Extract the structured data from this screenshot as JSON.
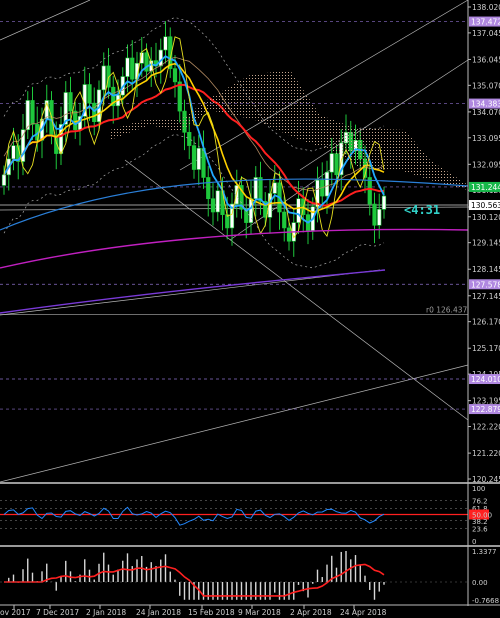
{
  "chart_data": {
    "type": "candlestick",
    "price_axis": {
      "ticks": [
        "138.020",
        "137.045",
        "136.045",
        "135.070",
        "134.070",
        "133.095",
        "132.095",
        "131.120",
        "130.120",
        "129.145",
        "128.145",
        "127.145",
        "126.170",
        "125.170",
        "124.195",
        "123.195",
        "122.220",
        "121.220",
        "120.245"
      ],
      "levels": [
        {
          "label": "137.472",
          "price": 137.472,
          "color": "#b088e0"
        },
        {
          "label": "134.383",
          "price": 134.383,
          "color": "#b088e0"
        },
        {
          "label": "131.244",
          "price": 131.244,
          "color": "#17b84a"
        },
        {
          "label": "130.563",
          "price": 130.563,
          "color": "#ffffff"
        },
        {
          "label": "127.578",
          "price": 127.578,
          "color": "#b088e0"
        },
        {
          "label": "124.010",
          "price": 124.01,
          "color": "#b088e0"
        },
        {
          "label": "122.879",
          "price": 122.879,
          "color": "#b088e0"
        }
      ],
      "fibo_note": "r0 126.437"
    },
    "countdown": "<4:31",
    "date_labels": [
      "ov 2017",
      "7 Dec 2017",
      "2 Jan 2018",
      "24 Jan 2018",
      "15 Feb 2018",
      "9 Mar 2018",
      "2 Apr 2018",
      "24 Apr 2018"
    ],
    "closes": [
      131.7,
      132.3,
      132.8,
      132.2,
      133.4,
      134.5,
      133.6,
      133.0,
      133.8,
      134.5,
      133.2,
      132.5,
      133.6,
      134.8,
      134.1,
      133.4,
      133.9,
      135.1,
      134.4,
      133.7,
      134.9,
      135.8,
      135.0,
      134.3,
      134.7,
      135.4,
      136.1,
      135.3,
      135.9,
      136.3,
      135.6,
      136.0,
      135.8,
      136.4,
      136.9,
      135.7,
      135.2,
      134.1,
      133.3,
      132.8,
      131.9,
      132.7,
      131.6,
      130.8,
      130.3,
      131.1,
      130.2,
      129.7,
      130.6,
      131.3,
      130.4,
      129.9,
      130.8,
      131.6,
      130.7,
      130.1,
      131.0,
      131.4,
      130.3,
      129.7,
      129.2,
      129.9,
      130.8,
      130.2,
      129.6,
      130.5,
      131.5,
      130.9,
      131.8,
      132.5,
      131.7,
      132.9,
      133.3,
      132.6,
      133.0,
      132.3,
      131.6,
      130.6,
      129.8,
      130.4,
      130.9
    ],
    "rsi": {
      "levels": [
        "100",
        "76.2",
        "61.8",
        "50.00",
        "38.2",
        "23.6",
        "0"
      ]
    },
    "macd": {
      "labels": [
        "1.3377",
        "0.00",
        "-0.7668"
      ]
    }
  }
}
